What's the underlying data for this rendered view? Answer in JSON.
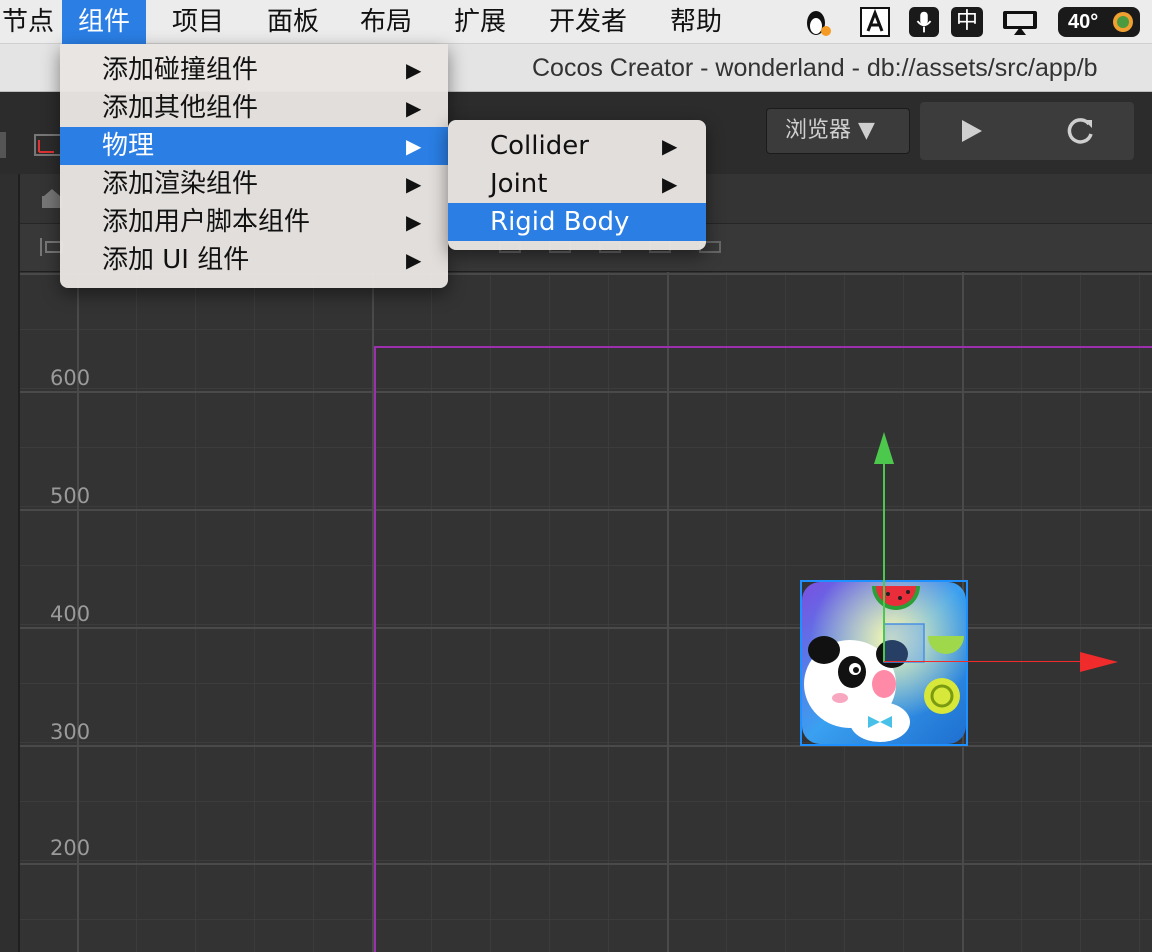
{
  "menubar": {
    "items": [
      {
        "label": "节点"
      },
      {
        "label": "组件"
      },
      {
        "label": "项目"
      },
      {
        "label": "面板"
      },
      {
        "label": "布局"
      },
      {
        "label": "扩展"
      },
      {
        "label": "开发者"
      },
      {
        "label": "帮助"
      }
    ],
    "input_method": "中",
    "temperature": "40°"
  },
  "window": {
    "title": "Cocos Creator - wonderland - db://assets/src/app/b"
  },
  "toolbar": {
    "preview_platform": "浏览器 ▼"
  },
  "component_menu": {
    "items": [
      {
        "label": "添加碰撞组件",
        "arrow": "▶"
      },
      {
        "label": "添加其他组件",
        "arrow": "▶"
      },
      {
        "label": "物理",
        "arrow": "▶"
      },
      {
        "label": "添加渲染组件",
        "arrow": "▶"
      },
      {
        "label": "添加用户脚本组件",
        "arrow": "▶"
      },
      {
        "label": "添加 UI 组件",
        "arrow": "▶"
      }
    ]
  },
  "physics_submenu": {
    "items": [
      {
        "label": "Collider",
        "arrow": "▶"
      },
      {
        "label": "Joint",
        "arrow": "▶"
      },
      {
        "label": "Rigid Body",
        "arrow": ""
      }
    ]
  },
  "scene": {
    "y_axis_labels": [
      "600",
      "500",
      "400",
      "300",
      "200"
    ],
    "colors": {
      "canvas_border": "#9b2fae",
      "y_gizmo": "#4cc94c",
      "x_gizmo": "#f02b2b",
      "selection": "#1e90ff"
    }
  }
}
